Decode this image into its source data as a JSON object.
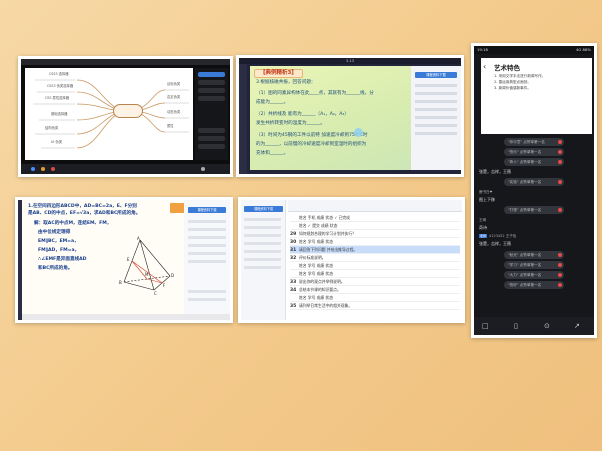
{
  "mindmap": {
    "nodes": [
      "CSS3 选择器",
      "CSS3 伪类选择器",
      "CSS 属性选择器",
      "基础选择器",
      "结构伪类",
      "UI 伪类",
      "目标伪类",
      "否定伪类",
      "动态伪类",
      "属性",
      "层次",
      "伪元素"
    ]
  },
  "lesson_slide": {
    "window_title": "3-13",
    "heading": "【典例精析3】",
    "intro": "3.根据核磁共振，回答问题：",
    "line1": "（1）图的同素异构体在此",
    "line1b": "____点，其就有为______线，分",
    "line2": "成能为______。",
    "line3": "（2）共析线及",
    "line3b": "能有为______（A₁，A₂，A₃）",
    "line4": "发生共析转变时的温度为______。",
    "line5": "（3）时间为45钢的工件以前特",
    "line5b": "加速度冷却到750℃时",
    "line6": "的为______，以前慢的冷却速度冷却到室温时的组织为",
    "line7": "充体和______。",
    "panel_header": "课程资料下载"
  },
  "phone_chat": {
    "status_time": "19:18",
    "status_right": "4G 88%",
    "back_glyph": "‹",
    "art_title": "艺术特色",
    "items": [
      "1. 采用文学手法进行新闻写作。",
      "2. 善运用典型点面刻。",
      "3. 新闻价值感新事件。"
    ],
    "pills": [
      "\"你乐意\" 点赞单第一名",
      "\"快乐\" 点赞单第一名",
      "\"奇人\" 点赞单第一名",
      "\"实验\" 点赞单第一名",
      "\"打怪\" 点赞单第一名",
      "\"秋光\" 点赞单第一名",
      "\"学习\" 点赞单第一名",
      "\"大力\" 点赞单第一名",
      "\"快好\" 点赞单第一名"
    ],
    "messages": [
      "张楚，吉祥，王薇",
      "鹿书白❤",
      "图上下移",
      "王琳",
      "奇诗",
      "张楚，吉祥，王薇"
    ],
    "tag": "老师",
    "tag_name": "4123452 王子怡",
    "bottom_icons": [
      "□",
      "▯",
      "⊙",
      "↗"
    ]
  },
  "geometry_slide": {
    "problem1": "1.在空间四边形ABCD中，AD=BC=2a，E、F分别",
    "problem2": "是AB、CD的中点，EF=√3a，求AD和BC所成的角。",
    "sol1": "解：取AC的中点M，连结EM、FM，",
    "sol2": "由中位线定理得",
    "sol3": "EM∥BC，EM=a，",
    "sol4": "FM∥AD，FM=a，",
    "sol5": "∴∠EMF是异面直线AD",
    "sol6": "和BC所成的角。",
    "panel_header": "课程资料下载",
    "labels": {
      "A": "A",
      "B": "B",
      "C": "C",
      "D": "D",
      "E": "E",
      "F": "F",
      "M": "M"
    }
  },
  "spreadsheet": {
    "panel_header": "课程资料下载",
    "rows": [
      {
        "n": "",
        "text": "姓名  手机    成绩  状态    ✓ 已完成"
      },
      {
        "n": "",
        "text": "姓名  ✓ 提交  成绩  状态"
      },
      {
        "n": "29",
        "text": "如何规划合理的学习计划并执行？"
      },
      {
        "n": "30",
        "text": "姓名  学号    成绩  状态"
      },
      {
        "n": "31",
        "text": "请回答下列问题 并给出推导过程。"
      },
      {
        "n": "32",
        "text": "评价标准说明。"
      },
      {
        "n": "",
        "text": "姓名  学号    成绩  状态"
      },
      {
        "n": "",
        "text": "姓名  学号    成绩  状态"
      },
      {
        "n": "33",
        "text": "说出你的观点并举例说明。"
      },
      {
        "n": "34",
        "text": "总结本节课的知识要点。"
      },
      {
        "n": "",
        "text": "姓名  学号    成绩  状态"
      },
      {
        "n": "35",
        "text": "请列举日常生活中的相关现象。"
      }
    ]
  }
}
